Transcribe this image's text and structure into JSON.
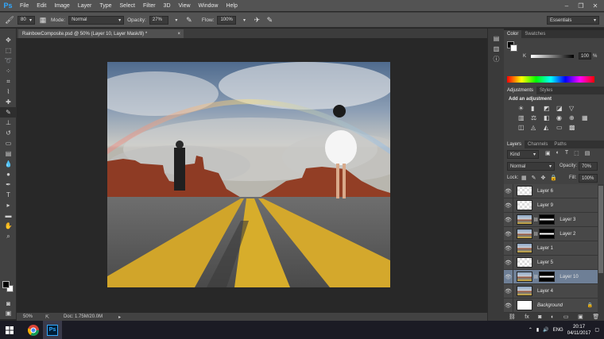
{
  "menubar": {
    "logo": "Ps",
    "items": [
      "File",
      "Edit",
      "Image",
      "Layer",
      "Type",
      "Select",
      "Filter",
      "3D",
      "View",
      "Window",
      "Help"
    ]
  },
  "options": {
    "brush_size": "80",
    "mode_label": "Mode:",
    "mode_value": "Normal",
    "opacity_label": "Opacity:",
    "opacity_value": "27%",
    "flow_label": "Flow:",
    "flow_value": "100%",
    "workspace": "Essentials"
  },
  "document": {
    "tab_title": "RainbowComposite.psd @ 50% (Layer 10, Layer Mask/8) *",
    "zoom": "50%",
    "doc_info": "Doc: 1.75M/20.0M"
  },
  "color_panel": {
    "tabs": [
      "Color",
      "Swatches"
    ],
    "channel": "K",
    "value": "100",
    "unit": "%"
  },
  "adjustments_panel": {
    "tabs": [
      "Adjustments",
      "Styles"
    ],
    "heading": "Add an adjustment"
  },
  "layers_panel": {
    "tabs": [
      "Layers",
      "Channels",
      "Paths"
    ],
    "filter": "Kind",
    "blend_mode": "Normal",
    "opacity_label": "Opacity:",
    "opacity_value": "70%",
    "lock_label": "Lock:",
    "fill_label": "Fill:",
    "fill_value": "100%",
    "layers": [
      {
        "name": "Layer 6",
        "thumb": "checker",
        "mask": false,
        "selected": false
      },
      {
        "name": "Layer 9",
        "thumb": "checker",
        "mask": false,
        "selected": false
      },
      {
        "name": "Layer 3",
        "thumb": "photo",
        "mask": true,
        "selected": false
      },
      {
        "name": "Layer 2",
        "thumb": "photo",
        "mask": true,
        "selected": false
      },
      {
        "name": "Layer 1",
        "thumb": "photo",
        "mask": false,
        "selected": false
      },
      {
        "name": "Layer 5",
        "thumb": "checker",
        "mask": false,
        "selected": false
      },
      {
        "name": "Layer 10",
        "thumb": "photo",
        "mask": true,
        "selected": true
      },
      {
        "name": "Layer 4",
        "thumb": "photo",
        "mask": false,
        "selected": false
      },
      {
        "name": "Background",
        "thumb": "white",
        "mask": false,
        "selected": false
      }
    ]
  },
  "taskbar": {
    "language": "ENG",
    "time": "20:17",
    "date": "04/11/2017"
  }
}
